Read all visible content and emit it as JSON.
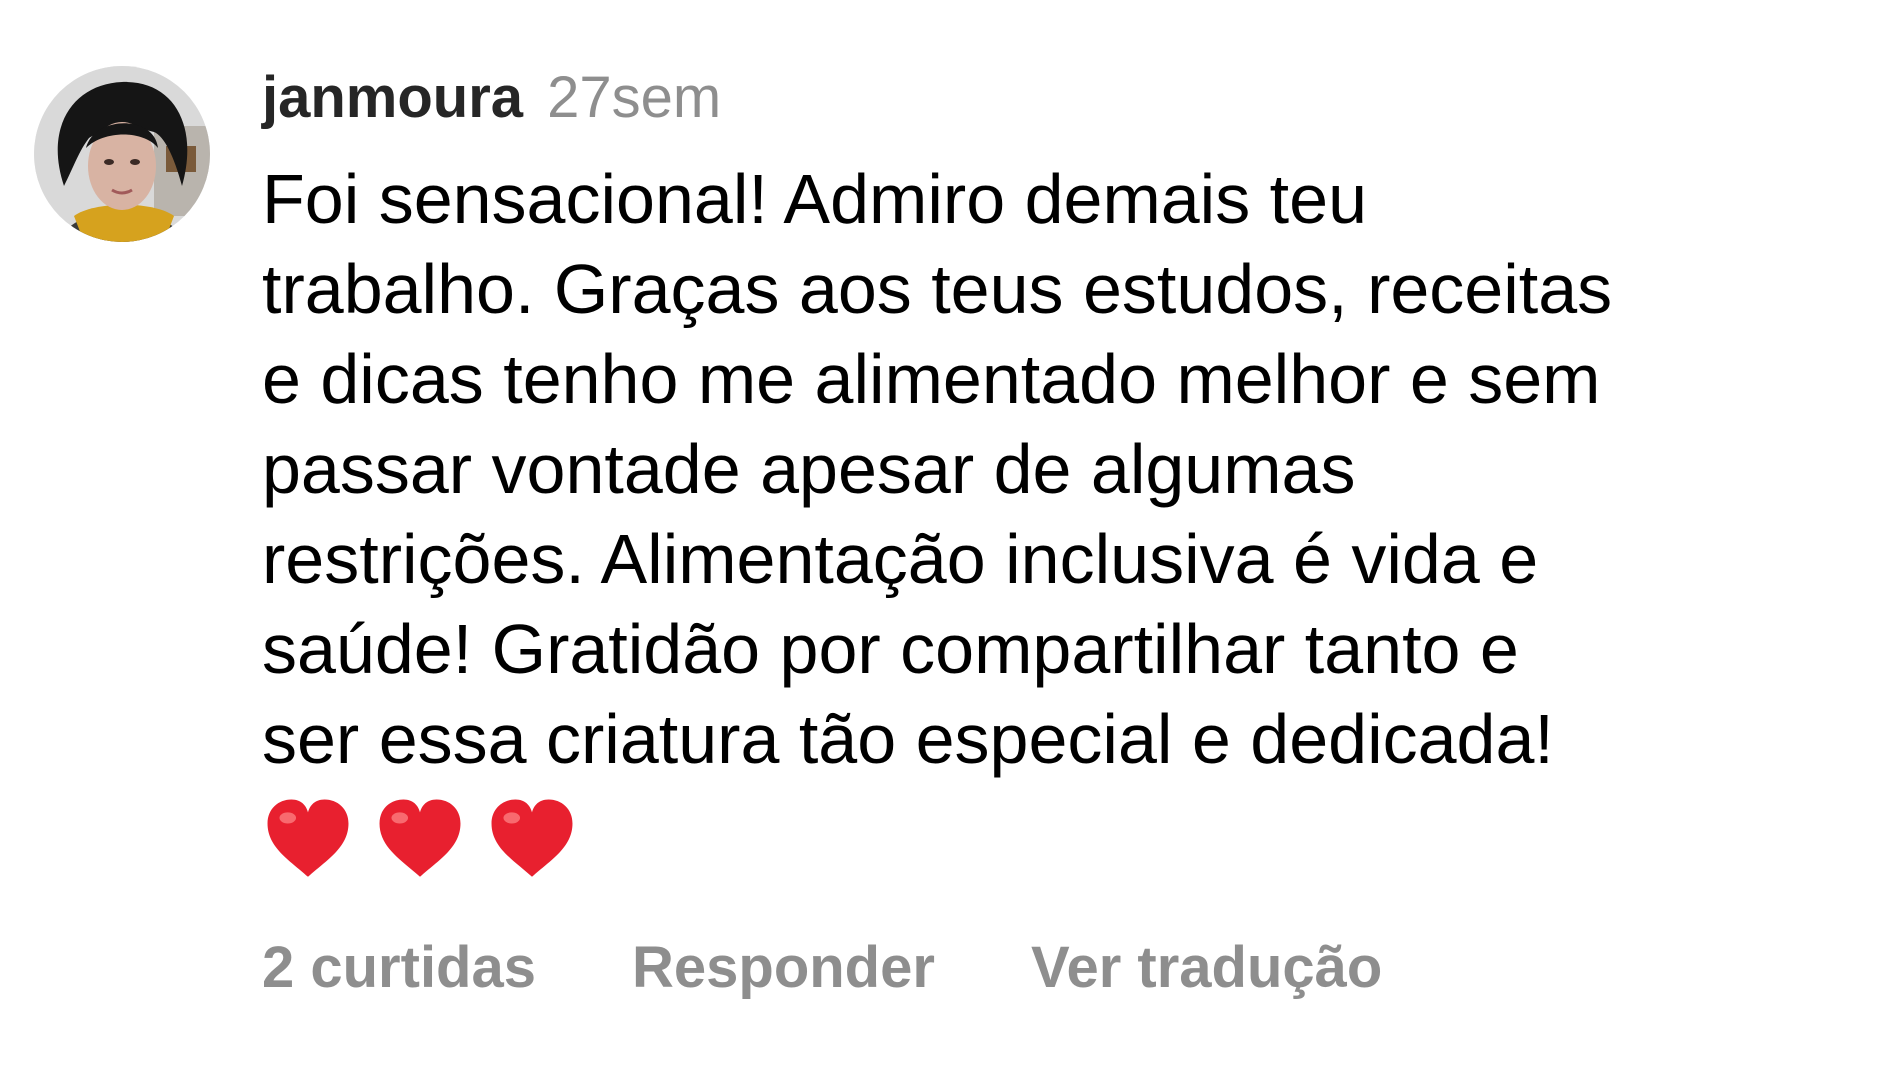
{
  "comment": {
    "username": "janmoura",
    "timestamp": "27sem",
    "text_lines": [
      "Foi sensacional! Admiro demais teu",
      "trabalho. Graças aos teus estudos, receitas",
      "e dicas tenho me alimentado melhor e sem",
      "passar vontade apesar de algumas",
      "restrições. Alimentação inclusiva é vida e",
      "saúde!  Gratidão por compartilhar tanto e",
      "ser essa criatura tão especial e dedicada!"
    ],
    "emojis": [
      "red-heart-icon",
      "red-heart-icon",
      "red-heart-icon"
    ],
    "actions": {
      "likes": "2 curtidas",
      "reply": "Responder",
      "translate": "Ver tradução"
    }
  },
  "colors": {
    "username": "#262626",
    "muted": "#8e8e8e",
    "text": "#000000",
    "heart": "#e8202f"
  }
}
